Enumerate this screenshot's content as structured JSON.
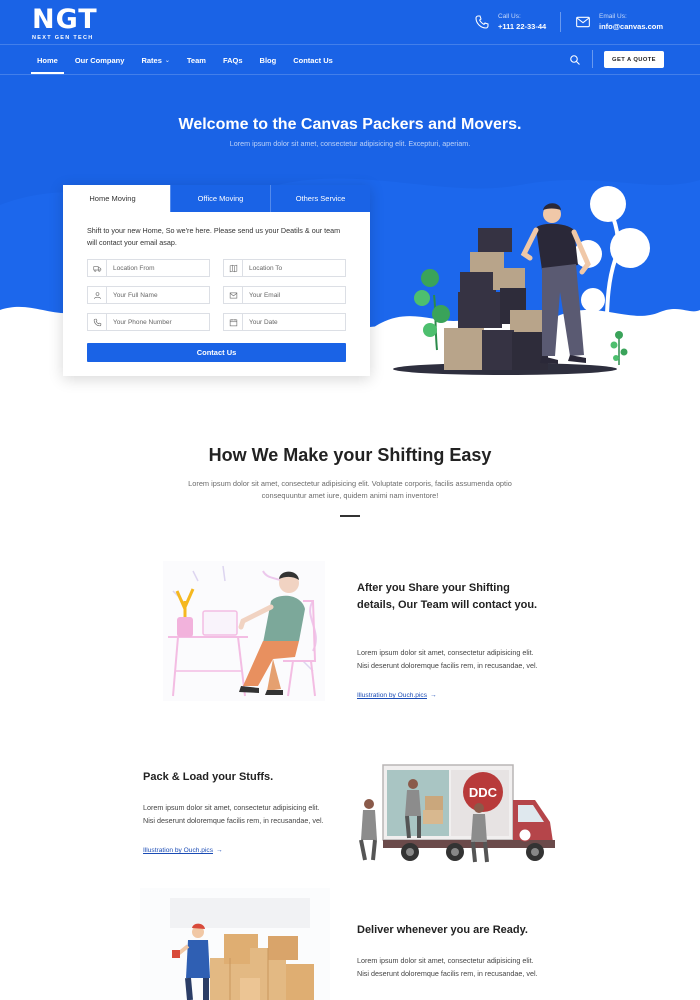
{
  "header": {
    "logo_mark": "NGT",
    "logo_sub": "NEXT GEN TECH",
    "phone_label": "Call Us:",
    "phone_value": "+111 22-33-44",
    "email_label": "Email Us:",
    "email_value": "info@canvas.com"
  },
  "nav": {
    "items": [
      {
        "label": "Home"
      },
      {
        "label": "Our Company"
      },
      {
        "label": "Rates"
      },
      {
        "label": "Team"
      },
      {
        "label": "FAQs"
      },
      {
        "label": "Blog"
      },
      {
        "label": "Contact Us"
      }
    ],
    "quote_label": "GET A QUOTE"
  },
  "hero": {
    "title": "Welcome to the Canvas Packers and Movers.",
    "subtitle": "Lorem ipsum dolor sit amet, consectetur adipisicing elit. Excepturi, aperiam."
  },
  "form": {
    "tabs": [
      "Home Moving",
      "Office Moving",
      "Others Service"
    ],
    "intro": "Shift to your new Home, So we're here. Please send us your Deatils & our team will contact your email asap.",
    "fields": {
      "location_from": "Location From",
      "location_to": "Location To",
      "full_name": "Your Full Name",
      "email": "Your Email",
      "phone": "Your Phone Number",
      "date": "Your Date"
    },
    "submit_label": "Contact Us"
  },
  "section": {
    "title": "How We Make your Shifting Easy",
    "subtitle": "Lorem ipsum dolor sit amet, consectetur adipisicing elit. Voluptate corporis, facilis assumenda optio consequuntur amet iure, quidem animi nam inventore!"
  },
  "features": [
    {
      "title": "After you Share your Shifting details, Our Team will contact you.",
      "body": "Lorem ipsum dolor sit amet, consectetur adipisicing elit. Nisi deserunt doloremque facilis rem, in recusandae, vel.",
      "link": "Illustration by Ouch.pics"
    },
    {
      "title": "Pack & Load your Stuffs.",
      "body": "Lorem ipsum dolor sit amet, consectetur adipisicing elit. Nisi deserunt doloremque facilis rem, in recusandae, vel.",
      "link": "Illustration by Ouch.pics"
    },
    {
      "title": "Deliver whenever you are Ready.",
      "body": "Lorem ipsum dolor sit amet, consectetur adipisicing elit. Nisi deserunt doloremque facilis rem, in recusandae, vel."
    }
  ],
  "truck_logo": "DDC",
  "colors": {
    "brand_blue": "#1a63e6",
    "text_dark": "#222222",
    "link_blue": "#1a4bb5"
  },
  "icons": [
    "phone-icon",
    "mail-icon",
    "search-icon",
    "truck-icon",
    "map-icon",
    "user-icon",
    "envelope-icon",
    "phone-call-icon",
    "calendar-icon",
    "arrow-right-icon"
  ]
}
